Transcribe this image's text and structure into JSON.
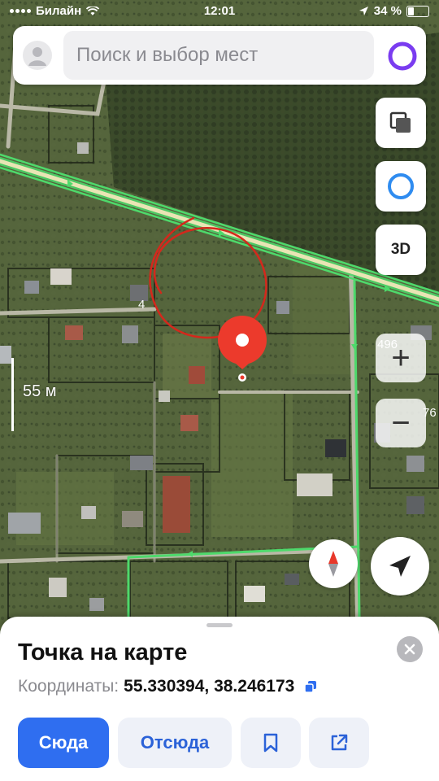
{
  "status_bar": {
    "carrier": "Билайн",
    "time": "12:01",
    "battery": "34 %",
    "battery_level": 0.34
  },
  "search": {
    "placeholder": "Поиск и выбор мест",
    "icons": {
      "profile": "person-icon",
      "assistant": "alice-icon"
    }
  },
  "map_controls": {
    "three_d_label": "3D",
    "zoom_in": "+",
    "zoom_out": "−",
    "icons": {
      "layers": "layers-icon",
      "assistant": "alice-icon",
      "compass": "compass-icon",
      "locate": "navigation-arrow-icon"
    }
  },
  "map": {
    "scale_label": "55 м",
    "labels": [
      "4",
      "496",
      "76"
    ]
  },
  "place_card": {
    "title": "Точка на карте",
    "coordinates_label": "Координаты:",
    "coordinates_value": "55.330394, 38.246173",
    "buttons": {
      "to_here": "Сюда",
      "from_here": "Отсюда"
    },
    "icons": {
      "close": "close-icon",
      "copy": "copy-icon",
      "bookmark": "bookmark-icon",
      "share": "share-icon"
    }
  },
  "colors": {
    "accent": "#2f6ef0",
    "marker": "#ec3a2c",
    "road_highlight": "#4ed96b",
    "annotation": "#d4281c"
  }
}
